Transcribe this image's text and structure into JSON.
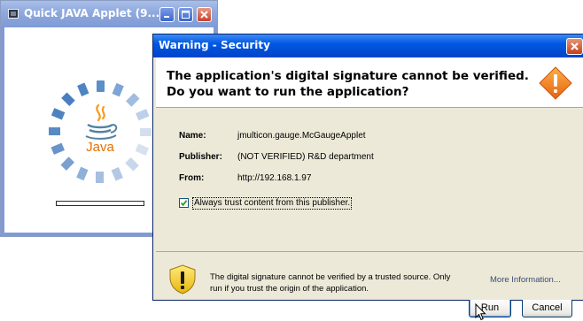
{
  "applet_window": {
    "title": "Quick JAVA Applet (9...",
    "logo_text": "Java",
    "progress": 0
  },
  "security_dialog": {
    "title": "Warning - Security",
    "heading_line1": "The application's digital signature cannot be verified.",
    "heading_line2": "Do you want to run the application?",
    "details": {
      "name_label": "Name:",
      "name_value": "jmulticon.gauge.McGaugeApplet",
      "publisher_label": "Publisher:",
      "publisher_value": "(NOT VERIFIED) R&D department",
      "from_label": "From:",
      "from_value": "http://192.168.1.97"
    },
    "always_trust": {
      "label": "Always trust content from this publisher.",
      "checked": true
    },
    "buttons": {
      "run": "Run",
      "cancel": "Cancel"
    },
    "footer": {
      "line1": "The digital signature cannot be verified by a trusted source.  Only",
      "line2": "run if you trust the origin of the application.",
      "more_info": "More Information..."
    }
  },
  "icons": {
    "warning": "warning-diamond-icon",
    "shield": "shield-warning-icon",
    "cursor": "mouse-pointer-icon"
  },
  "colors": {
    "dialog_titlebar": "#0058e3",
    "applet_titlebar": "#8fa8dc",
    "warning_orange": "#f07a1a",
    "java_blue": "#5382a1",
    "java_orange": "#f89820"
  }
}
